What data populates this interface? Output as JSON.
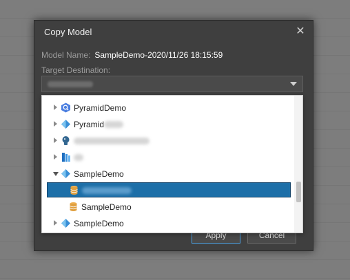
{
  "dialog": {
    "title": "Copy Model",
    "model_name_label": "Model Name:",
    "model_name_value": "SampleDemo-2020/11/26 18:15:59",
    "target_label": "Target Destination:",
    "apply_label": "Apply",
    "cancel_label": "Cancel",
    "close_glyph": "✕"
  },
  "tree": {
    "items": [
      {
        "label": "PyramidDemo",
        "icon": "bigquery-icon"
      },
      {
        "label": "Pyramid",
        "icon": "pyramid-icon"
      },
      {
        "label": "",
        "icon": "postgres-icon"
      },
      {
        "label": "",
        "icon": "azure-icon"
      },
      {
        "label": "SampleDemo",
        "icon": "pyramid-icon"
      },
      {
        "label": "",
        "icon": "database-icon"
      },
      {
        "label": "SampleDemo",
        "icon": "database-icon"
      },
      {
        "label": "SampleDemo",
        "icon": "pyramid-icon"
      }
    ]
  },
  "colors": {
    "selection": "#1d6fa8",
    "apply_border": "#4da3e6",
    "database_icon": "#e0a040",
    "pyramid_icon": "#3a8fd6"
  }
}
